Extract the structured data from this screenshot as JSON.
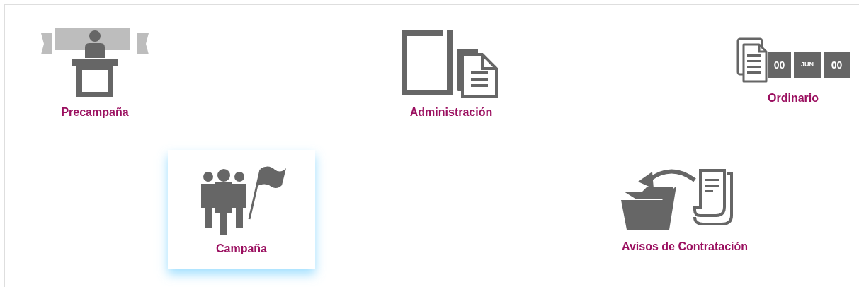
{
  "tiles": [
    {
      "kind": "lectern",
      "label": "Precampaña",
      "selected": false
    },
    {
      "kind": "documents",
      "label": "Administración",
      "selected": false
    },
    {
      "kind": "calendar",
      "label": "Ordinario",
      "selected": false,
      "calendar_texts": [
        "00",
        "JUN",
        "00"
      ]
    },
    {
      "kind": "group",
      "label": "Campaña",
      "selected": true
    },
    {
      "kind": "transfer",
      "label": "Avisos de Contratación",
      "selected": false
    }
  ]
}
